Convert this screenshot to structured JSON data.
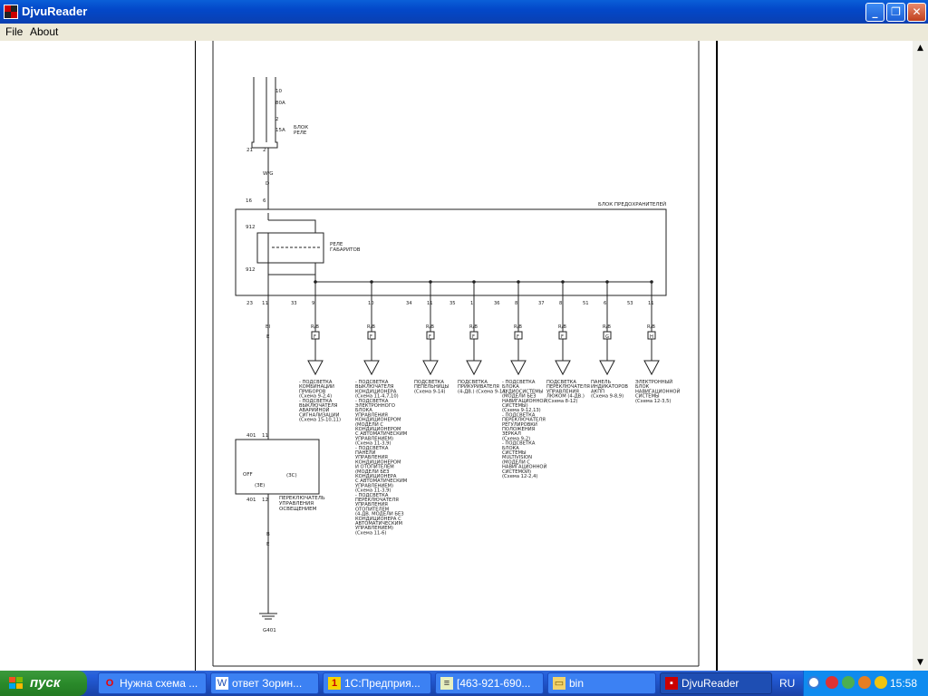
{
  "window": {
    "title": "DjvuReader"
  },
  "menu": [
    {
      "label": "File"
    },
    {
      "label": "About"
    }
  ],
  "document": {
    "fuses": [
      {
        "num": "10",
        "amp": "80A"
      },
      {
        "num": "2",
        "amp": "15A"
      }
    ],
    "relay_block_label": [
      "БЛОК",
      "РЕЛЕ"
    ],
    "top_connector": {
      "conn": "21",
      "pin": "2"
    },
    "top_wire": {
      "color": "W/G",
      "letter": "D"
    },
    "fuse_box": {
      "label": "БЛОК ПРЕДОХРАНИТЕЛЕЙ",
      "conn": "16",
      "pin": "6",
      "id_top": "912",
      "id_bot": "912"
    },
    "relay": [
      "РЕЛЕ",
      "ГАБАРИТОВ"
    ],
    "left_out": {
      "conn": "23",
      "pin": "11",
      "wire": "Bl",
      "letter": "E"
    },
    "outputs": [
      {
        "conn": "33",
        "pin": "9",
        "wire": "R/B",
        "letter": "F",
        "desc": [
          "- ПОДСВЕТКА",
          "КОМБИНАЦИИ",
          "ПРИБОРОВ",
          "(Схема 9-2,4)",
          "- ПОДСВЕТКА",
          "ВЫКЛЮЧАТЕЛЯ",
          "АВАРИЙНОЙ",
          "СИГНАЛИЗАЦИИ",
          "(Схема 15-10,11)"
        ]
      },
      {
        "conn": "",
        "pin": "10",
        "wire": "R/B",
        "letter": "F",
        "desc": [
          "- ПОДСВЕТКА",
          "ВЫКЛЮЧАТЕЛЯ",
          "КОНДИЦИОНЕРА",
          "(Схема 11-4,7,10)",
          "- ПОДСВЕТКА",
          "ЭЛЕКТРОННОГО",
          "БЛОКА",
          "УПРАВЛЕНИЯ",
          "КОНДИЦИОНЕРОМ",
          "(МОДЕЛИ С",
          "КОНДИЦИОНЕРОМ",
          "С АВТОМАТИЧЕСКИМ",
          "УПРАВЛЕНИЕМ)",
          "(Схема 11-3,9)",
          "- ПОДСВЕТКА",
          "ПАНЕЛИ",
          "УПРАВЛЕНИЯ",
          "КОНДИЦИОНЕРОМ",
          "И ОТОПИТЕЛЕМ",
          "(МОДЕЛИ БЕЗ",
          "КОНДИЦИОНЕРА",
          "С АВТОМАТИЧЕСКИМ",
          "УПРАВЛЕНИЕМ)",
          "(Схема 11-3,9)",
          "- ПОДСВЕТКА",
          "ПЕРЕКЛЮЧАТЕЛЯ",
          "УПРАВЛЕНИЯ",
          "ОТОПИТЕЛЕМ",
          "(4-ДВ. МОДЕЛИ БЕЗ",
          "КОНДИЦИОНЕРА С",
          "АВТОМАТИЧЕСКИМ",
          "УПРАВЛЕНИЕМ)",
          "(Схема 11-6)"
        ]
      },
      {
        "conn": "34",
        "pin": "11",
        "wire": "R/B",
        "letter": "F",
        "desc": [
          "ПОДСВЕТКА",
          "ПЕПЕЛЬНИЦЫ",
          "(Схема 9-14)"
        ]
      },
      {
        "conn": "35",
        "pin": "1",
        "wire": "R/B",
        "letter": "F",
        "desc": [
          "ПОДСВЕТКА",
          "ПРИКУРИВАТЕЛЯ",
          "(4-ДВ.) (Схема 9-14)"
        ]
      },
      {
        "conn": "36",
        "pin": "8",
        "wire": "R/B",
        "letter": "F",
        "desc": [
          "- ПОДСВЕТКА",
          "БЛОКА",
          "АУДИОСИСТЕМЫ",
          "(МОДЕЛИ БЕЗ",
          "НАВИГАЦИОННОЙ",
          "СИСТЕМЫ)",
          "(Схема 9-12,13)",
          "- ПОДСВЕТКА",
          "ПЕРЕКЛЮЧАТЕЛЯ",
          "РЕГУЛИРОВКИ",
          "ПОЛОЖЕНИЯ",
          "ЗЕРКАЛ",
          "(Схема 9-2)",
          "- ПОДСВЕТКА",
          "БЛОКА",
          "СИСТЕМЫ",
          "MULTIVISION",
          "(МОДЕЛИ С",
          "НАВИГАЦИОННОЙ",
          "СИСТЕМОЙ)",
          "(Схема 12-2,4)"
        ]
      },
      {
        "conn": "37",
        "pin": "8",
        "wire": "R/B",
        "letter": "F",
        "desc": [
          "ПОДСВЕТКА",
          "ПЕРЕКЛЮЧАТЕЛЯ",
          "УПРАВЛЕНИЯ",
          "ЛЮКОМ (4-ДВ.)",
          "(Схема 8-12)"
        ]
      },
      {
        "conn": "51",
        "pin": "6",
        "wire": "R/B",
        "letter": "G",
        "desc": [
          "ПАНЕЛЬ",
          "ИНДИКАТОРОВ",
          "АКПП",
          "(Схема 9-8,9)"
        ]
      },
      {
        "conn": "53",
        "pin": "11",
        "wire": "R/B",
        "letter": "H",
        "desc": [
          "ЭЛЕКТРОННЫЙ",
          "БЛОК",
          "НАВИГАЦИОННОЙ",
          "СИСТЕМЫ",
          "(Схема 12-3,5)"
        ]
      }
    ],
    "switch": {
      "conn_top": "401",
      "pin_top": "11",
      "conn_bot": "401",
      "pin_bot": "12",
      "off": "OFF",
      "pos2": "(ЗС)",
      "pos3": "(ЗЕ)",
      "label": [
        "ПЕРЕКЛЮЧАТЕЛЬ",
        "УПРАВЛЕНИЯ",
        "ОСВЕЩЕНИЕМ"
      ]
    },
    "ground": {
      "wire": "B",
      "letter": "E",
      "label": "G401"
    }
  },
  "taskbar": {
    "start": "пуск",
    "tasks": [
      {
        "label": "Нужна схема ...",
        "icon": "opera-icon"
      },
      {
        "label": "ответ Зорин...",
        "icon": "word-icon"
      },
      {
        "label": "1С:Предприя...",
        "icon": "1c-icon"
      },
      {
        "label": "[463-921-690...",
        "icon": "notepad-icon"
      },
      {
        "label": "bin",
        "icon": "folder-icon"
      },
      {
        "label": "DjvuReader",
        "icon": "djvu-icon"
      }
    ],
    "lang": "RU",
    "clock": "15:58"
  },
  "colors": {
    "titlebar": "#0348c9",
    "taskbar": "#245edb",
    "start": "#2a8a2a",
    "tray": "#0f8bef"
  }
}
